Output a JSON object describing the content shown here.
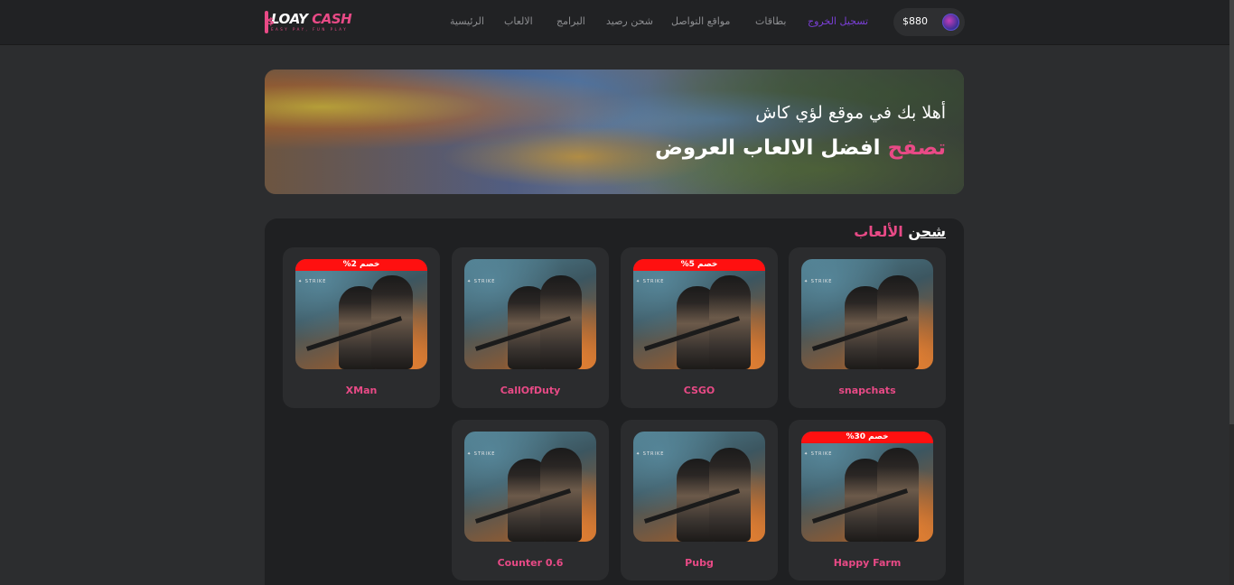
{
  "header": {
    "logo": {
      "title_white": "LOAY",
      "title_pink": "CASH",
      "tagline": "EASY PAY, FUN PLAY"
    },
    "nav": [
      {
        "label": "الرئيسية",
        "active": false
      },
      {
        "label": "الالعاب",
        "active": false
      },
      {
        "label": "البرامج",
        "active": false
      },
      {
        "label": "شحن رصيد",
        "active": false
      },
      {
        "label": "مواقع التواصل",
        "active": false
      },
      {
        "label": "بطاقات",
        "active": false
      },
      {
        "label": "تسجيل الخروج",
        "active": true
      }
    ],
    "wallet": {
      "balance": "$880"
    }
  },
  "hero": {
    "line1": "أهلا بك في موقع لؤي كاش",
    "line2_accent": "تصفح",
    "line2_rest": "افضل الالعاب العروض"
  },
  "section": {
    "title_white": "شحن",
    "title_pink": "الألعاب"
  },
  "cards": [
    {
      "name": "snapchats",
      "discount": ""
    },
    {
      "name": "CSGO",
      "discount": "خصم 5%"
    },
    {
      "name": "CallOfDuty",
      "discount": ""
    },
    {
      "name": "XMan",
      "discount": "خصم 2%"
    },
    {
      "name": "Happy Farm",
      "discount": "خصم 30%"
    },
    {
      "name": "Pubg",
      "discount": ""
    },
    {
      "name": "Counter 0.6",
      "discount": ""
    }
  ],
  "colors": {
    "accent": "#e84a86",
    "active_nav": "#7a3fd6",
    "discount_badge": "#ff1010",
    "background": "#2c2d2f",
    "header": "#212224"
  }
}
